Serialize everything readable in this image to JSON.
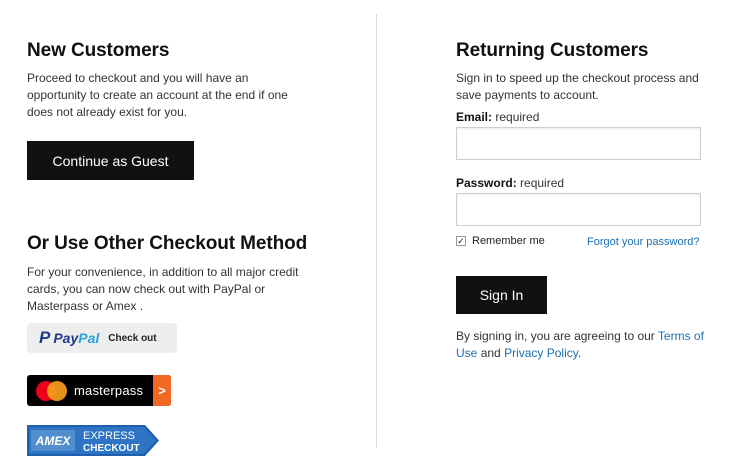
{
  "new_customers": {
    "title": "New Customers",
    "description": "Proceed to checkout and you will have an opportunity to create an account at the end if one does not already exist for you.",
    "guest_button": "Continue as Guest"
  },
  "other_methods": {
    "title": "Or Use Other Checkout Method",
    "description": "For your convenience, in addition to all major credit cards, you can now check out with PayPal or Masterpass or Amex .",
    "paypal": {
      "word_a": "Pay",
      "word_b": "Pal",
      "action": "Check out"
    },
    "masterpass": {
      "label": "masterpass",
      "arrow": ">"
    },
    "amex": {
      "brand": "AMEX",
      "line1": "EXPRESS",
      "line2": "CHECKOUT"
    }
  },
  "returning_customers": {
    "title": "Returning Customers",
    "description": "Sign in to speed up the checkout process and save payments to account.",
    "email": {
      "label": "Email:",
      "required": "required",
      "value": ""
    },
    "password": {
      "label": "Password:",
      "required": "required",
      "value": ""
    },
    "remember_me": {
      "label": "Remember me",
      "checked": true,
      "mark": "✓"
    },
    "forgot_link": "Forgot your password?",
    "sign_in_button": "Sign In",
    "terms": {
      "prefix": "By signing in, you are agreeing to our",
      "terms_link": "Terms of Use",
      "and": "and",
      "privacy_link": "Privacy Policy",
      "suffix": "."
    }
  },
  "colors": {
    "button_bg": "#111111",
    "link": "#1a6fb5",
    "paypal_dark": "#1f3a8a",
    "paypal_light": "#2aa4e0",
    "mastercard_red": "#eb001b",
    "mastercard_orange": "#f79e1b",
    "amex_blue": "#1f5fae"
  }
}
